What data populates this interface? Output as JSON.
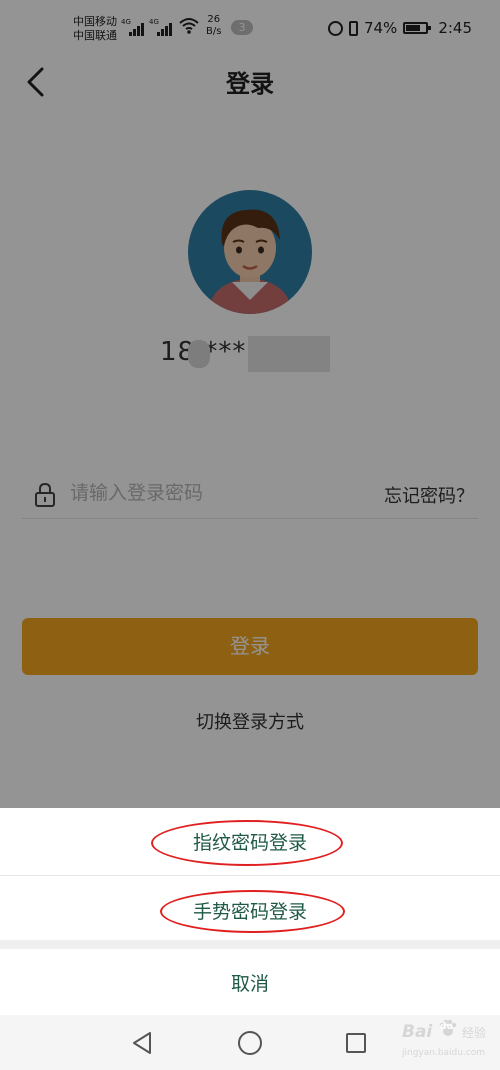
{
  "status_bar": {
    "carrier_1": "中国移动",
    "carrier_2": "中国联通",
    "net_type_1": "4G",
    "net_type_2": "4G",
    "speed_value": "26",
    "speed_unit": "B/s",
    "notification_count": "3",
    "battery_text": "74%",
    "battery_level": 0.74,
    "time": "2:45"
  },
  "header": {
    "title": "登录",
    "back_icon": "chevron-left-icon"
  },
  "profile": {
    "account_masked": "18 ***"
  },
  "password": {
    "placeholder": "请输入登录密码",
    "icon": "lock-icon",
    "forgot_label": "忘记密码？"
  },
  "login_button": {
    "label": "登录"
  },
  "switch_method": {
    "label": "切换登录方式"
  },
  "action_sheet": {
    "options": [
      {
        "label": "指纹密码登录",
        "highlighted": true
      },
      {
        "label": "手势密码登录",
        "highlighted": true
      }
    ],
    "cancel_label": "取消"
  },
  "nav_bar": {
    "icons": [
      "back-triangle-icon",
      "home-circle-icon",
      "recents-square-icon"
    ]
  },
  "watermark": {
    "brand": "Bai",
    "paw": "du",
    "site": "jingyan.baidu.com",
    "suffix": "经验"
  },
  "colors": {
    "accent": "#f5a81f",
    "sheet_text": "#1f5a45",
    "annotation_ring": "#e02020",
    "overlay": "rgba(0,0,0,0.42)"
  }
}
